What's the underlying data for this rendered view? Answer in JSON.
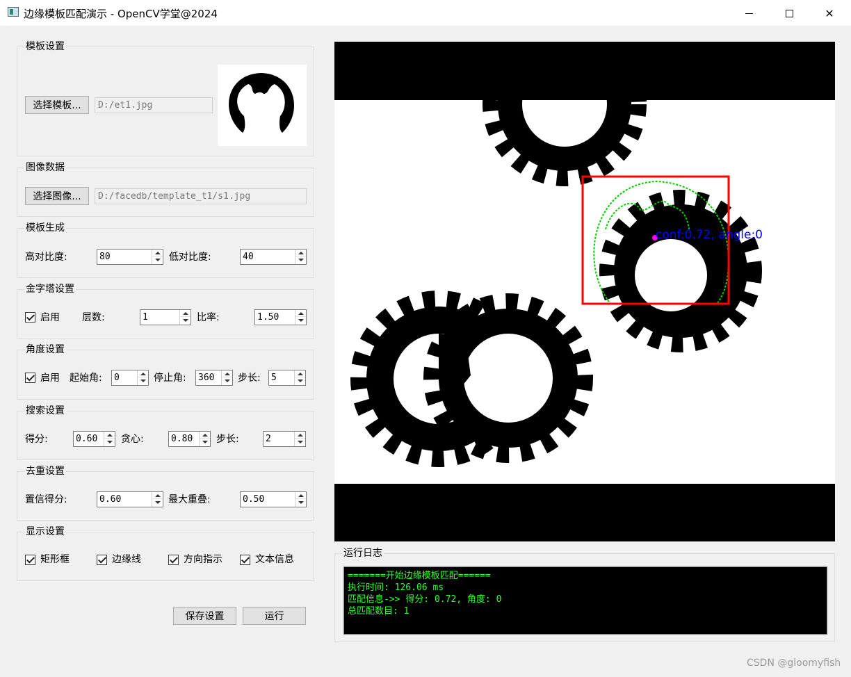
{
  "window": {
    "title": "边缘模板匹配演示 - OpenCV学堂@2024",
    "minimize": "—",
    "maximize": "☐",
    "close": "✕"
  },
  "template_settings": {
    "title": "模板设置",
    "select_button": "选择模板...",
    "path": "D:/et1.jpg"
  },
  "image_data": {
    "title": "图像数据",
    "select_button": "选择图像...",
    "path": "D:/facedb/template_t1/s1.jpg"
  },
  "template_gen": {
    "title": "模板生成",
    "high_contrast_label": "高对比度:",
    "high_contrast_value": "80",
    "low_contrast_label": "低对比度:",
    "low_contrast_value": "40"
  },
  "pyramid": {
    "title": "金字塔设置",
    "enable_label": "启用",
    "enabled": true,
    "levels_label": "层数:",
    "levels_value": "1",
    "ratio_label": "比率:",
    "ratio_value": "1.50"
  },
  "angle": {
    "title": "角度设置",
    "enable_label": "启用",
    "enabled": true,
    "start_label": "起始角:",
    "start_value": "0",
    "stop_label": "停止角:",
    "stop_value": "360",
    "step_label": "步长:",
    "step_value": "5"
  },
  "search": {
    "title": "搜索设置",
    "score_label": "得分:",
    "score_value": "0.60",
    "greedy_label": "贪心:",
    "greedy_value": "0.80",
    "step_label": "步长:",
    "step_value": "2"
  },
  "dedup": {
    "title": "去重设置",
    "conf_label": "置信得分:",
    "conf_value": "0.60",
    "overlap_label": "最大重叠:",
    "overlap_value": "0.50"
  },
  "display": {
    "title": "显示设置",
    "rect_label": "矩形框",
    "edge_label": "边缘线",
    "dir_label": "方向指示",
    "text_label": "文本信息"
  },
  "actions": {
    "save": "保存设置",
    "run": "运行"
  },
  "viewer": {
    "annotation": "conf:0.72, angle:0",
    "box_color": "#ff0000",
    "edge_color": "#00cc00",
    "text_color": "#0000ff",
    "center_color": "#ff00ff"
  },
  "log": {
    "title": "运行日志",
    "lines": [
      "=======开始边缘模板匹配======",
      "执行时间: 126.06 ms",
      "匹配信息->> 得分: 0.72,  角度: 0",
      "总匹配数目: 1"
    ]
  },
  "watermark": "CSDN @gloomyfish"
}
